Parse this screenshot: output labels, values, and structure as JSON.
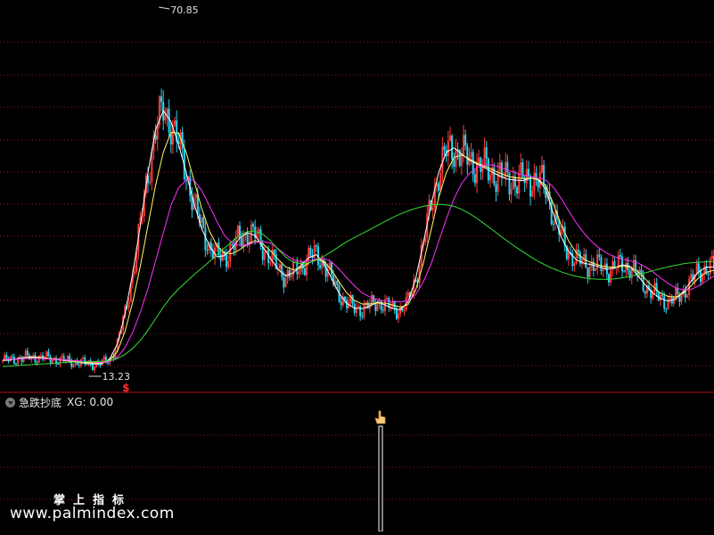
{
  "chart_data": {
    "type": "candlestick",
    "main_panel": {
      "price_annotations": {
        "high_label": "70.85",
        "low_label": "13.23"
      },
      "signal_marker": "$",
      "ma_lines": [
        {
          "color": "#ffffff",
          "values": [
            17.2,
            17.3,
            17.6,
            17.8,
            17.9,
            17.8,
            17.6,
            17.4,
            17.2,
            17.0,
            16.8,
            16.6,
            16.5,
            16.6,
            17.5,
            20.5,
            26.5,
            34.5,
            44.0,
            54.5,
            63.0,
            66.8,
            64.6,
            60.0,
            54.5,
            48.5,
            43.5,
            40.0,
            37.8,
            38.0,
            39.5,
            41.5,
            42.6,
            42.0,
            39.8,
            37.5,
            35.3,
            34.0,
            34.6,
            36.0,
            37.6,
            38.2,
            36.5,
            33.5,
            30.5,
            28.5,
            27.6,
            27.5,
            28.0,
            28.8,
            28.2,
            27.5,
            27.3,
            28.8,
            33.5,
            40.5,
            48.0,
            54.5,
            58.5,
            59.4,
            58.2,
            57.0,
            56.2,
            55.5,
            54.6,
            53.8,
            53.2,
            53.0,
            52.9,
            53.4,
            53.1,
            51.2,
            46.3,
            41.8,
            38.8,
            37.2,
            36.5,
            36.2,
            35.8,
            35.3,
            35.6,
            36.2,
            35.9,
            34.1,
            32.2,
            30.6,
            29.5,
            29.0,
            29.4,
            30.9,
            32.9,
            34.8,
            35.7,
            35.8
          ]
        },
        {
          "color": "#ffff66",
          "values": [
            17.3,
            17.4,
            17.5,
            17.7,
            17.8,
            17.8,
            17.6,
            17.5,
            17.3,
            17.1,
            17.0,
            16.8,
            16.7,
            16.7,
            17.2,
            19.0,
            23.0,
            28.8,
            36.0,
            44.0,
            52.0,
            58.5,
            62.5,
            62.3,
            58.5,
            53.0,
            47.5,
            43.0,
            40.0,
            38.5,
            38.4,
            39.2,
            40.3,
            41.0,
            40.4,
            39.0,
            37.3,
            35.8,
            35.2,
            35.6,
            36.5,
            37.3,
            36.9,
            35.1,
            32.8,
            30.6,
            29.1,
            28.4,
            28.4,
            28.6,
            28.6,
            28.2,
            27.8,
            28.3,
            31.2,
            36.5,
            43.0,
            49.5,
            54.5,
            57.5,
            58.0,
            57.2,
            56.4,
            55.8,
            55.1,
            54.4,
            53.8,
            53.5,
            53.3,
            53.4,
            53.2,
            51.9,
            48.3,
            44.2,
            40.9,
            38.6,
            37.3,
            36.6,
            36.1,
            35.8,
            35.7,
            35.9,
            35.8,
            34.9,
            33.4,
            31.9,
            30.6,
            29.9,
            29.8,
            30.6,
            32.0,
            33.6,
            34.7,
            35.1
          ]
        },
        {
          "color": "#ff33ff",
          "values": [
            17.4,
            17.4,
            17.5,
            17.6,
            17.6,
            17.6,
            17.5,
            17.4,
            17.3,
            17.2,
            17.1,
            17.0,
            16.9,
            16.8,
            17.0,
            17.8,
            19.8,
            22.8,
            26.8,
            31.5,
            37.0,
            42.5,
            48.0,
            51.5,
            53.0,
            53.0,
            51.0,
            48.0,
            44.8,
            42.0,
            40.5,
            40.0,
            40.2,
            40.6,
            40.8,
            40.5,
            39.4,
            38.2,
            37.2,
            36.8,
            37.0,
            37.3,
            37.5,
            36.8,
            35.3,
            33.6,
            32.0,
            30.6,
            29.8,
            29.3,
            29.0,
            28.9,
            28.8,
            29.1,
            30.3,
            32.8,
            36.3,
            40.8,
            45.3,
            49.3,
            52.3,
            54.3,
            55.5,
            56.0,
            56.0,
            55.6,
            55.0,
            54.5,
            54.0,
            53.7,
            53.5,
            53.0,
            51.6,
            49.4,
            46.9,
            44.5,
            42.5,
            40.8,
            39.5,
            38.5,
            37.8,
            37.3,
            37.0,
            36.6,
            35.8,
            34.8,
            33.6,
            32.5,
            31.6,
            31.2,
            31.3,
            32.0,
            33.0,
            34.0
          ]
        },
        {
          "color": "#33dd33",
          "values": [
            16.0,
            16.1,
            16.2,
            16.3,
            16.4,
            16.5,
            16.6,
            16.7,
            16.8,
            16.9,
            16.9,
            17.0,
            17.0,
            17.0,
            17.2,
            17.6,
            18.4,
            19.6,
            21.2,
            23.2,
            25.5,
            27.8,
            29.8,
            31.4,
            32.8,
            34.2,
            35.5,
            36.8,
            38.2,
            39.5,
            40.8,
            42.0,
            42.8,
            42.8,
            42.3,
            41.0,
            39.3,
            37.7,
            36.7,
            36.4,
            36.6,
            37.1,
            37.9,
            38.8,
            39.8,
            40.8,
            41.6,
            42.4,
            43.2,
            44.0,
            44.8,
            45.6,
            46.3,
            46.9,
            47.4,
            47.8,
            48.1,
            48.2,
            48.1,
            47.8,
            47.2,
            46.4,
            45.4,
            44.3,
            43.2,
            42.0,
            40.9,
            39.8,
            38.8,
            37.8,
            36.9,
            36.1,
            35.4,
            34.8,
            34.3,
            33.9,
            33.6,
            33.4,
            33.3,
            33.3,
            33.4,
            33.6,
            33.9,
            34.2,
            34.6,
            35.0,
            35.4,
            35.8,
            36.1,
            36.4,
            36.6,
            36.7,
            36.8,
            36.8
          ]
        }
      ]
    },
    "sub_panel": {
      "indicator_name": "急跌抄底",
      "indicator_label": "XG: 0.00"
    }
  },
  "icons": {
    "collapse": "chevron-down-icon",
    "cursor": "hand-pointer-icon"
  },
  "watermark": {
    "line1": "掌上指标",
    "line2": "www.palmindex.com"
  },
  "colors": {
    "background": "#000000",
    "grid": "#8b1a1a",
    "up": "#ff3b3b",
    "down": "#27d3f0",
    "separator": "#b01414",
    "signal": "#ffffff"
  }
}
